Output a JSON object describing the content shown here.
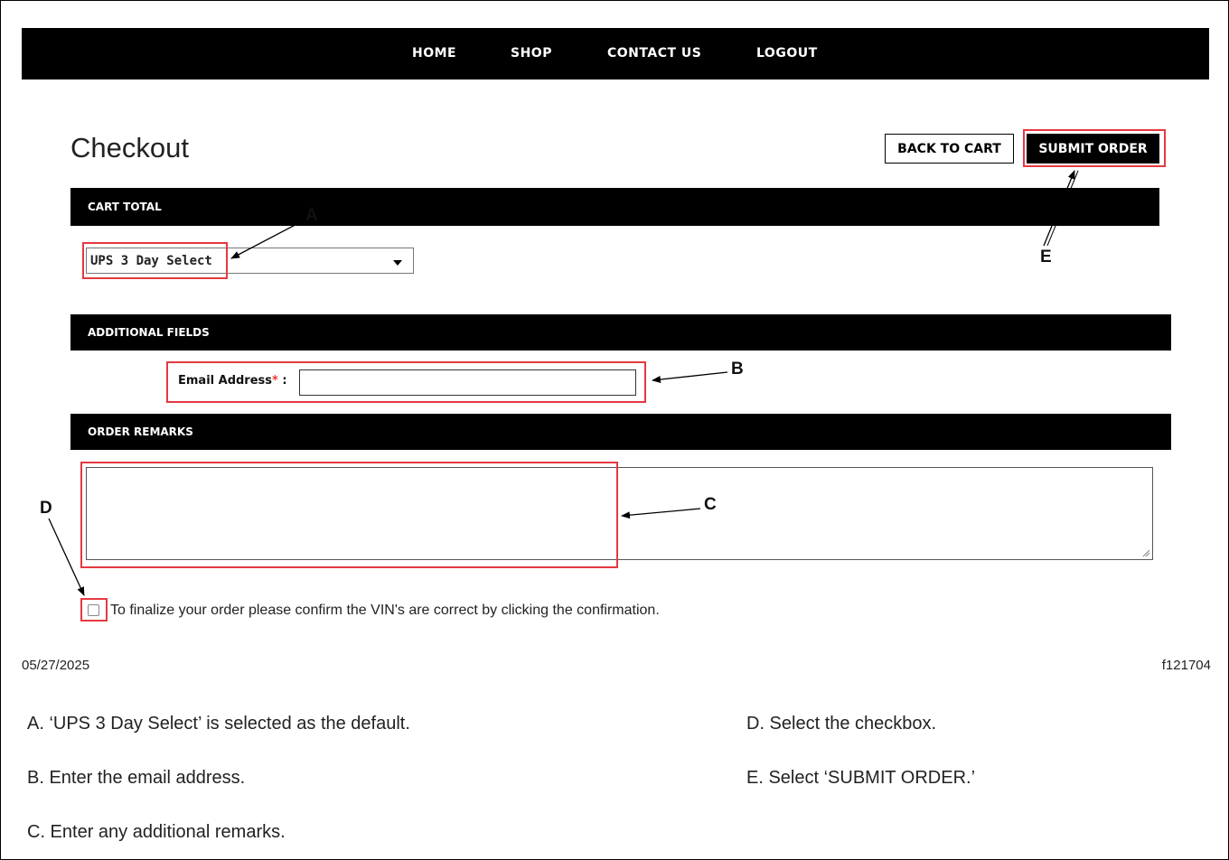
{
  "nav": {
    "items": [
      "HOME",
      "SHOP",
      "CONTACT US",
      "LOGOUT"
    ]
  },
  "page": {
    "title": "Checkout"
  },
  "buttons": {
    "back_to_cart": "BACK TO CART",
    "submit_order": "SUBMIT ORDER"
  },
  "sections": {
    "cart_total": "CART TOTAL",
    "additional_fields": "ADDITIONAL FIELDS",
    "order_remarks": "ORDER REMARKS"
  },
  "shipping": {
    "selected": "UPS 3 Day Select"
  },
  "email": {
    "label": "Email Address",
    "required_marker": "*",
    "colon": ":",
    "value": ""
  },
  "remarks": {
    "value": ""
  },
  "confirm": {
    "checked": false,
    "text": "To finalize your order please confirm the VIN's are correct by clicking the confirmation."
  },
  "footer": {
    "date": "05/27/2025",
    "figure_id": "f121704"
  },
  "callouts": {
    "a": "A",
    "b": "B",
    "c": "C",
    "d": "D",
    "e": "E"
  },
  "captions": {
    "a": "A. ‘UPS 3 Day Select’ is selected as the default.",
    "b": "B. Enter the email address.",
    "c": "C. Enter any additional remarks.",
    "d": "D. Select the checkbox.",
    "e": "E. Select ‘SUBMIT ORDER.’"
  },
  "colors": {
    "highlight": "#e53940",
    "bar": "#000000",
    "required": "#e53935"
  }
}
